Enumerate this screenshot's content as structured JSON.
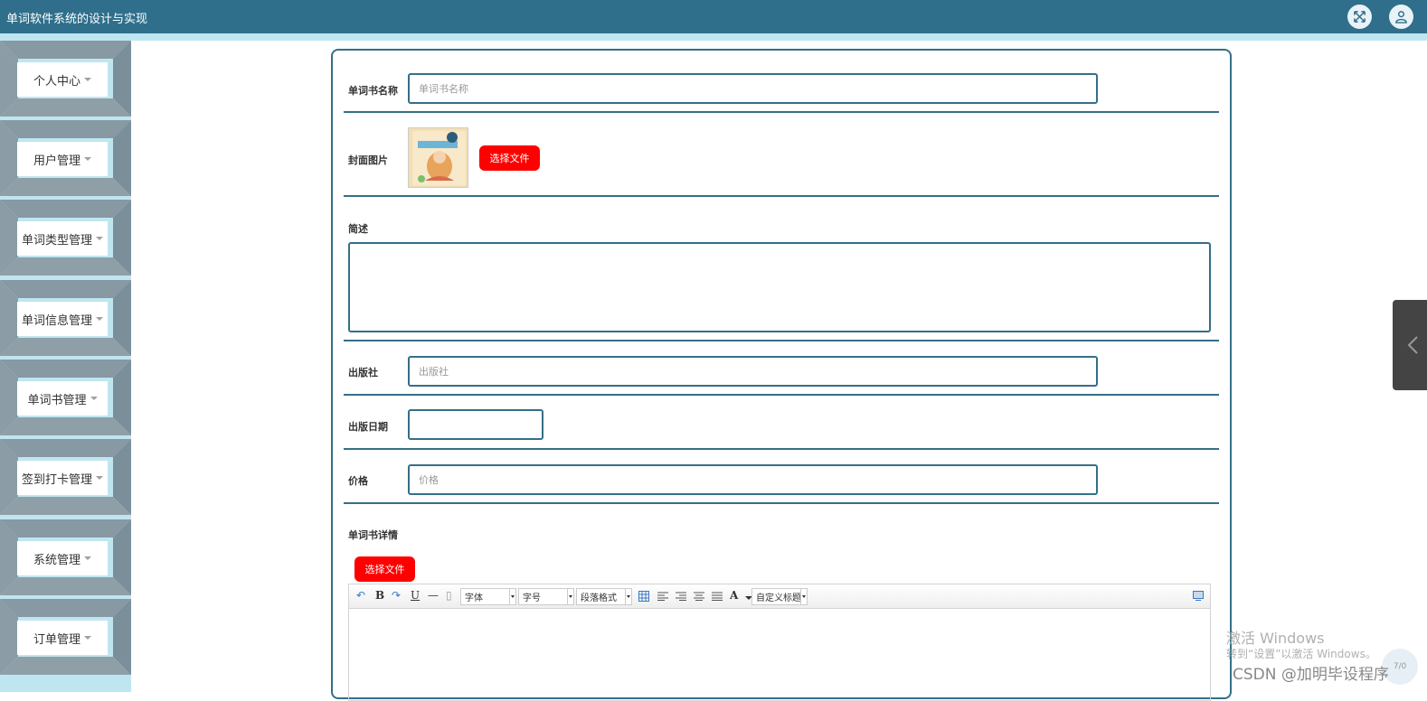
{
  "app": {
    "title": "单词软件系统的设计与实现"
  },
  "header_icons": [
    "fullscreen-icon",
    "user-icon"
  ],
  "sidebar": {
    "items": [
      {
        "label": "个人中心"
      },
      {
        "label": "用户管理"
      },
      {
        "label": "单词类型管理"
      },
      {
        "label": "单词信息管理"
      },
      {
        "label": "单词书管理"
      },
      {
        "label": "签到打卡管理"
      },
      {
        "label": "系统管理"
      },
      {
        "label": "订单管理"
      }
    ]
  },
  "form": {
    "name": {
      "label": "单词书名称",
      "placeholder": "单词书名称",
      "value": ""
    },
    "cover": {
      "label": "封面图片",
      "button": "选择文件"
    },
    "intro": {
      "label": "简述",
      "value": ""
    },
    "publisher": {
      "label": "出版社",
      "placeholder": "出版社",
      "value": ""
    },
    "publish_date": {
      "label": "出版日期",
      "value": ""
    },
    "price": {
      "label": "价格",
      "placeholder": "价格",
      "value": ""
    },
    "details": {
      "label": "单词书详情",
      "button": "选择文件",
      "toolbar": {
        "font": "字体",
        "size": "字号",
        "paragraph": "段落格式",
        "custom_title": "自定义标题",
        "bold": "B",
        "underline": "U",
        "font_color": "A"
      }
    }
  },
  "colors": {
    "header": "#2f6f8c",
    "accent_border": "#356f88",
    "sidebar_bg": "#bfe6f0",
    "button_red": "#ff0000"
  },
  "overlay": {
    "activate_title": "激活 Windows",
    "activate_hint": "转到“设置”以激活 Windows。",
    "watermark": "CSDN @加明毕设程序",
    "float_text": "7/0"
  }
}
